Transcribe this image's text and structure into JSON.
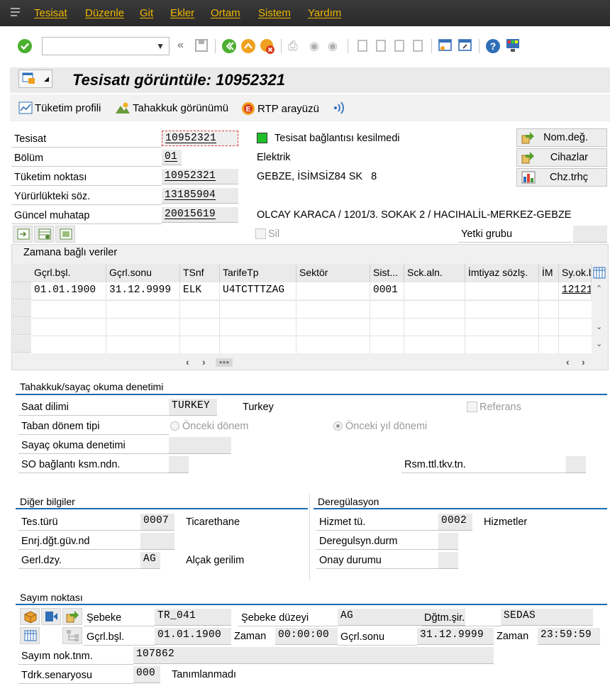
{
  "menu": [
    "Tesisat",
    "Düzenle",
    "Git",
    "Ekler",
    "Ortam",
    "Sistem",
    "Yardım"
  ],
  "title": "Tesisatı görüntüle: 10952321",
  "app_toolbar": {
    "consumption_profile": "Tüketim profili",
    "accrual_view": "Tahakkuk görünümü",
    "rtp_interface": "RTP arayüzü"
  },
  "header": {
    "installation_label": "Tesisat",
    "installation_value": "10952321",
    "division_label": "Bölüm",
    "division_value": "01",
    "consumption_point_label": "Tüketim noktası",
    "consumption_point_value": "10952321",
    "contract_label": "Yürürlükteki söz.",
    "contract_value": "13185904",
    "partner_label": "Güncel muhatap",
    "partner_value": "20015619",
    "status_text": "Tesisat bağlantısı kesilmedi",
    "division_text": "Elektrik",
    "address_text": "GEBZE, İSİMSİZ84 SK   8",
    "partner_text": "OLCAY KARACA / 1201/3. SOKAK 2 / HACIHALİL-MERKEZ-GEBZE",
    "delete_label": "Sil",
    "auth_group_label": "Yetki grubu",
    "status_color": "#1fbf2a"
  },
  "side_buttons": {
    "nom": "Nom.değ.",
    "devices": "Cihazlar",
    "device_history": "Chz.trhç"
  },
  "time_data": {
    "title": "Zamana bağlı veriler",
    "columns": [
      "Gçrl.bşl.",
      "Gçrl.sonu",
      "TSnf",
      "TarifeTp",
      "Sektör",
      "Sist...",
      "Sck.aln.",
      "İmtiyaz sözlş.",
      "İM",
      "Sy.ok.b"
    ],
    "row": [
      "01.01.1900",
      "31.12.9999",
      "ELK",
      "U4TCTTTZAG",
      "",
      "0001",
      "",
      "",
      "",
      "12121"
    ]
  },
  "billing": {
    "title": "Tahakkuk/sayaç okuma denetimi",
    "timezone_label": "Saat dilimi",
    "timezone_value": "TURKEY",
    "timezone_text": "Turkey",
    "reference_label": "Referans",
    "base_period_label": "Taban dönem tipi",
    "prev_period": "Önceki dönem",
    "prev_year_period": "Önceki yıl dönemi",
    "meter_reading_label": "Sayaç okuma denetimi",
    "so_label": "SO bağlantı ksm.ndn.",
    "rsm_label": "Rsm.ttl.tkv.tn."
  },
  "other": {
    "title": "Diğer bilgiler",
    "type_label": "Tes.türü",
    "type_value": "0007",
    "type_text": "Ticarethane",
    "energy_label": "Enrj.dğt.güv.nd",
    "voltage_label": "Gerl.dzy.",
    "voltage_value": "AG",
    "voltage_text": "Alçak gerilim"
  },
  "dereg": {
    "title": "Deregülasyon",
    "service_label": "Hizmet tü.",
    "service_value": "0002",
    "service_text": "Hizmetler",
    "status_label": "Deregulsyn.durm",
    "approval_label": "Onay durumu"
  },
  "meter_point": {
    "title": "Sayım noktası",
    "network_label": "Şebeke",
    "network_value": "TR_041",
    "network_level_label": "Şebeke düzeyi",
    "network_level_value": "AG",
    "dist_label": "Dğtm.şir.",
    "dist_value": "SEDAS",
    "valid_from_label": "Gçrl.bşl.",
    "valid_from_value": "01.01.1900",
    "time_label": "Zaman",
    "time_from_value": "00:00:00",
    "valid_to_label": "Gçrl.sonu",
    "valid_to_value": "31.12.9999",
    "time_to_value": "23:59:59",
    "desc_label": "Sayım nok.tnm.",
    "desc_value": "107862",
    "scenario_label": "Tdrk.senaryosu",
    "scenario_value": "000",
    "scenario_text": "Tanımlanmadı"
  }
}
